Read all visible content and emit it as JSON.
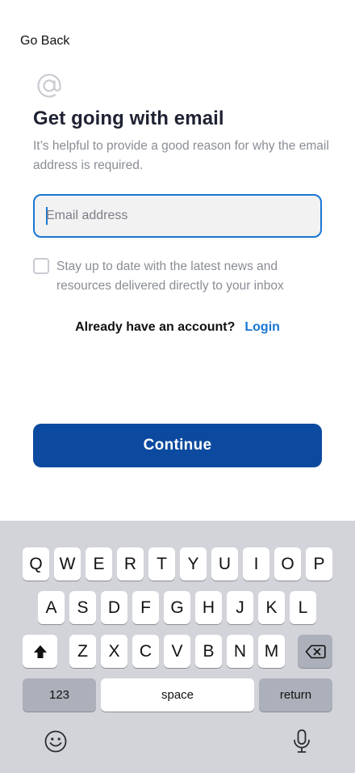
{
  "nav": {
    "back_label": "Go Back"
  },
  "header": {
    "icon": "at-sign-icon",
    "title": "Get going with email",
    "subtitle": "It’s helpful to provide a good reason for why the email address is required."
  },
  "form": {
    "email_placeholder": "Email address",
    "email_value": "",
    "newsletter_label": "Stay up to date with the latest news and resources delivered directly to your inbox",
    "newsletter_checked": false
  },
  "account": {
    "prompt": "Already have an account?",
    "login_label": "Login"
  },
  "actions": {
    "continue_label": "Continue"
  },
  "keyboard": {
    "row1": [
      "Q",
      "W",
      "E",
      "R",
      "T",
      "Y",
      "U",
      "I",
      "O",
      "P"
    ],
    "row2": [
      "A",
      "S",
      "D",
      "F",
      "G",
      "H",
      "J",
      "K",
      "L"
    ],
    "row3": [
      "Z",
      "X",
      "C",
      "V",
      "B",
      "N",
      "M"
    ],
    "shift_icon": "shift-icon",
    "delete_icon": "backspace-icon",
    "numbers_label": "123",
    "space_label": "space",
    "return_label": "return",
    "emoji_icon": "emoji-icon",
    "mic_icon": "microphone-icon"
  },
  "colors": {
    "accent": "#1976d2",
    "primary_button": "#0b4a9e",
    "keyboard_bg": "#d2d4da",
    "muted_text": "#8a8d96"
  }
}
